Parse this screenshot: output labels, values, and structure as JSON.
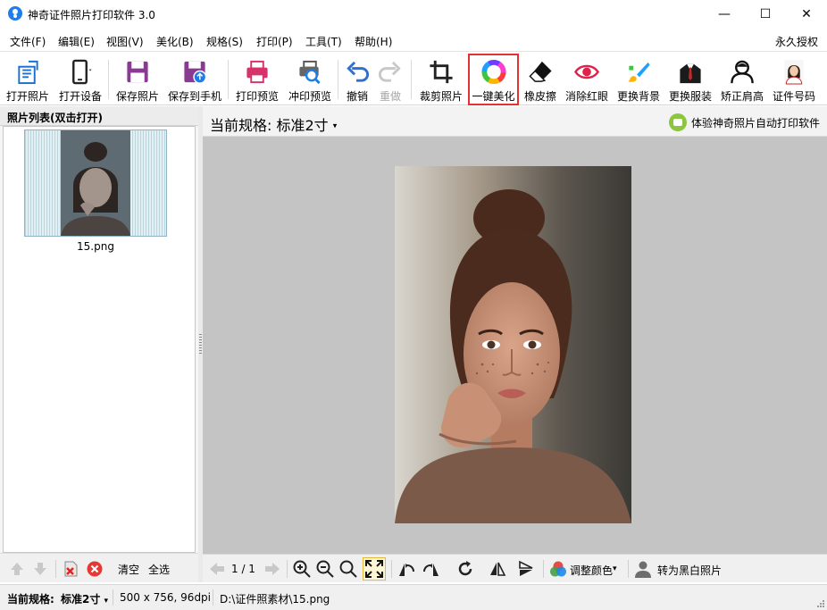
{
  "window": {
    "title": "神奇证件照片打印软件 3.0",
    "min_glyph": "—",
    "max_glyph": "☐",
    "close_glyph": "✕"
  },
  "menu": {
    "items": [
      "文件(F)",
      "编辑(E)",
      "视图(V)",
      "美化(B)",
      "规格(S)",
      "打印(P)",
      "工具(T)",
      "帮助(H)"
    ],
    "license": "永久授权"
  },
  "toolbar": {
    "buttons": [
      {
        "label": "打开照片",
        "icon": "open-photo-icon"
      },
      {
        "label": "打开设备",
        "icon": "phone-device-icon"
      },
      {
        "label": "保存照片",
        "icon": "save-icon"
      },
      {
        "label": "保存到手机",
        "icon": "save-to-phone-icon"
      },
      {
        "label": "打印预览",
        "icon": "printer-icon"
      },
      {
        "label": "冲印预览",
        "icon": "print-preview-icon"
      },
      {
        "label": "撤销",
        "icon": "undo-icon"
      },
      {
        "label": "重做",
        "icon": "redo-icon",
        "disabled": true
      },
      {
        "label": "裁剪照片",
        "icon": "crop-icon"
      },
      {
        "label": "一键美化",
        "icon": "color-wheel-icon",
        "highlighted": true
      },
      {
        "label": "橡皮擦",
        "icon": "eraser-icon"
      },
      {
        "label": "消除红眼",
        "icon": "red-eye-icon"
      },
      {
        "label": "更换背景",
        "icon": "brush-icon"
      },
      {
        "label": "更换服装",
        "icon": "suit-icon"
      },
      {
        "label": "矫正肩高",
        "icon": "shoulder-icon"
      },
      {
        "label": "证件号码",
        "icon": "id-photo-icon"
      }
    ]
  },
  "left_panel": {
    "title": "照片列表(双击打开)",
    "files": [
      {
        "name": "15.png"
      }
    ],
    "actions": {
      "clear": "清空",
      "select_all": "全选"
    }
  },
  "main": {
    "spec_prefix": "当前规格:",
    "spec_value": "标准2寸",
    "trial_link": "体验神奇照片自动打印软件"
  },
  "bottom_toolbar": {
    "page_indicator": "1 / 1",
    "adjust_color": "调整颜色",
    "to_bw": "转为黑白照片"
  },
  "status": {
    "spec_label": "当前规格:",
    "spec_value": "标准2寸",
    "image_info": "500 x 756, 96dpi",
    "file_path": "D:\\证件照素材\\15.png"
  },
  "colors": {
    "accent_blue": "#1e7de8",
    "highlight_red": "#e23333",
    "canvas_gray": "#c4c4c4"
  }
}
